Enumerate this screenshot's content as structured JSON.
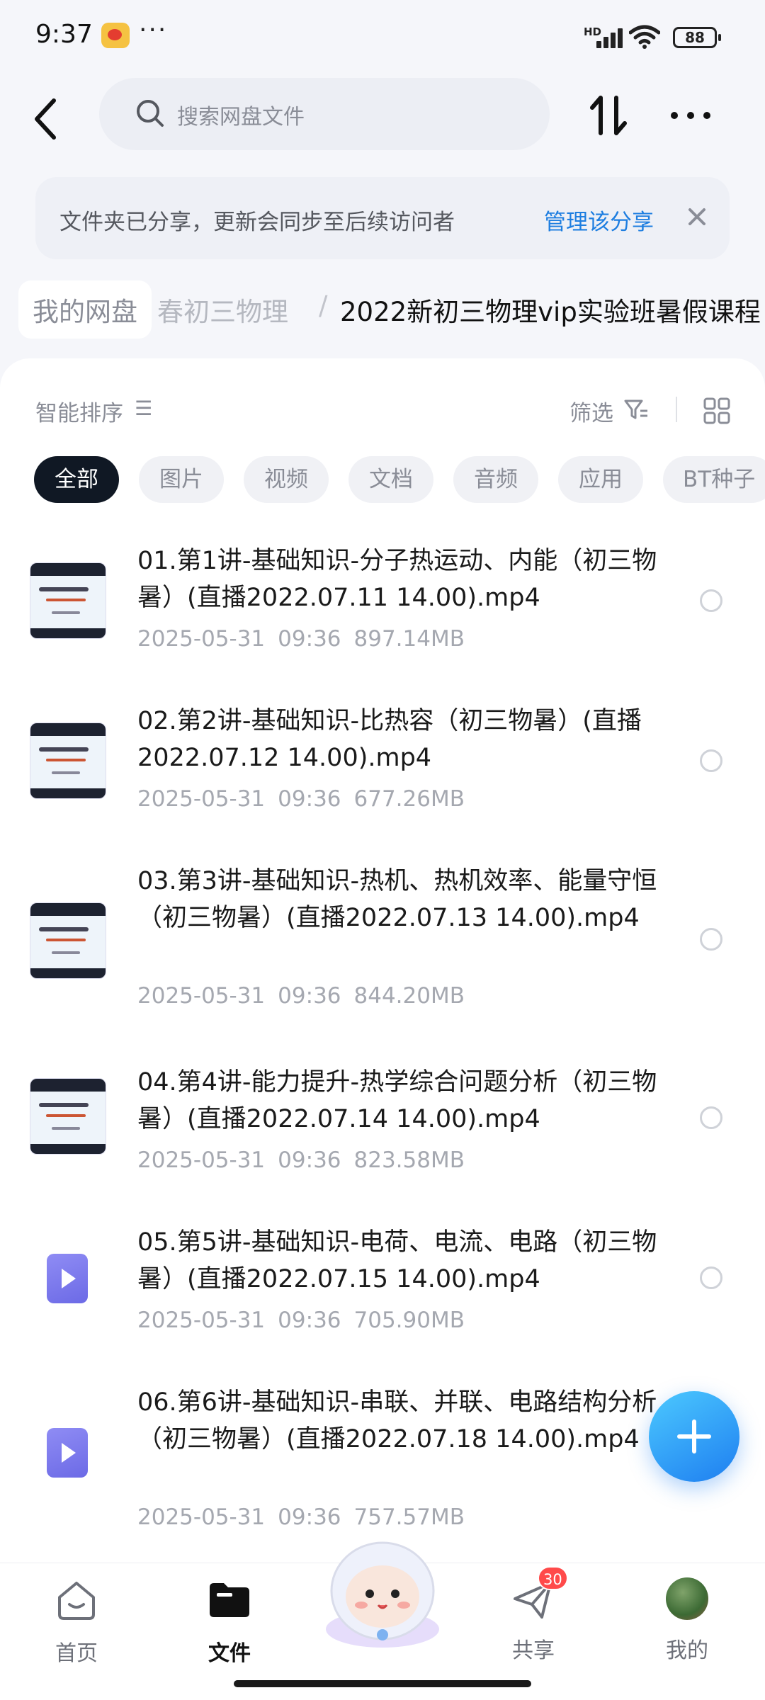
{
  "status_bar": {
    "time": "9:37",
    "network": "HD",
    "battery": "88"
  },
  "top_bar": {
    "search_placeholder": "搜索网盘文件"
  },
  "share_banner": {
    "text": "文件夹已分享，更新会同步至后续访问者",
    "manage_label": "管理该分享"
  },
  "breadcrumb": {
    "home": "我的网盘",
    "middle": "春初三物理",
    "separator": "/",
    "current": "2022新初三物理vip实验班暑假课程"
  },
  "toolbar": {
    "sort_label": "智能排序",
    "filter_label": "筛选"
  },
  "chips": [
    "全部",
    "图片",
    "视频",
    "文档",
    "音频",
    "应用",
    "BT种子"
  ],
  "files": [
    {
      "name": "01.第1讲-基础知识-分子热运动、内能（初三物暑）(直播2022.07.11 14.00).mp4",
      "date": "2025-05-31",
      "time": "09:36",
      "size": "897.14MB",
      "thumb": "slide"
    },
    {
      "name": "02.第2讲-基础知识-比热容（初三物暑）(直播2022.07.12 14.00).mp4",
      "date": "2025-05-31",
      "time": "09:36",
      "size": "677.26MB",
      "thumb": "slide"
    },
    {
      "name": "03.第3讲-基础知识-热机、热机效率、能量守恒（初三物暑）(直播2022.07.13 14.00).mp4",
      "date": "2025-05-31",
      "time": "09:36",
      "size": "844.20MB",
      "thumb": "slide"
    },
    {
      "name": "04.第4讲-能力提升-热学综合问题分析（初三物暑）(直播2022.07.14 14.00).mp4",
      "date": "2025-05-31",
      "time": "09:36",
      "size": "823.58MB",
      "thumb": "slide"
    },
    {
      "name": "05.第5讲-基础知识-电荷、电流、电路（初三物暑）(直播2022.07.15 14.00).mp4",
      "date": "2025-05-31",
      "time": "09:36",
      "size": "705.90MB",
      "thumb": "video"
    },
    {
      "name": "06.第6讲-基础知识-串联、并联、电路结构分析（初三物暑）(直播2022.07.18 14.00).mp4",
      "date": "2025-05-31",
      "time": "09:36",
      "size": "757.57MB",
      "thumb": "video"
    }
  ],
  "bottom_nav": [
    {
      "label": "首页",
      "icon": "home-icon"
    },
    {
      "label": "文件",
      "icon": "folder-icon",
      "active": true
    },
    {
      "label": "共享",
      "icon": "share-icon",
      "badge": "30"
    },
    {
      "label": "我的",
      "icon": "avatar"
    }
  ],
  "colors": {
    "accent": "#1e7ee0",
    "active_chip": "#101824",
    "badge": "#ff4a4a"
  }
}
